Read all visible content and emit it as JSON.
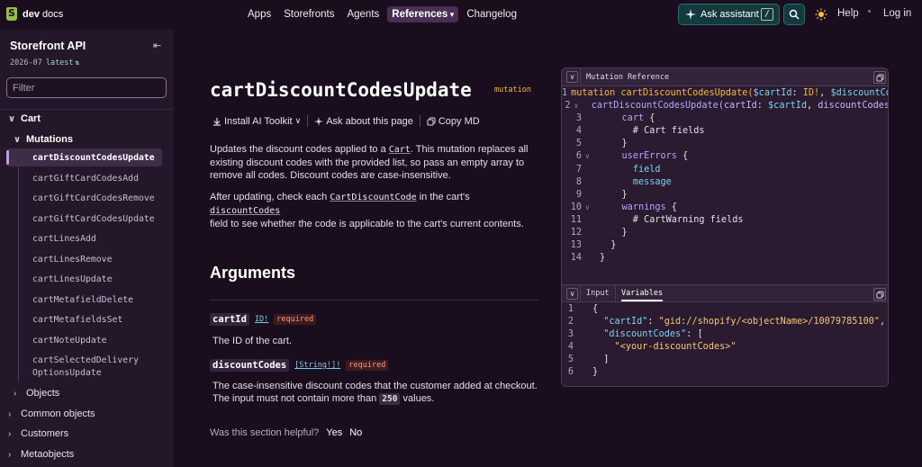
{
  "brand": {
    "name_bold": "dev",
    "name_rest": " docs"
  },
  "nav": {
    "links": [
      "Apps",
      "Storefronts",
      "Agents",
      "References",
      "Changelog"
    ],
    "active": "References",
    "ask_label": "Ask assistant",
    "ask_shortcut": "/",
    "help": "Help",
    "login": "Log in"
  },
  "sidebar": {
    "title": "Storefront API",
    "version": "2026-07",
    "version_tag": "latest",
    "filter_placeholder": "Filter",
    "section": "Cart",
    "subsection": "Mutations",
    "items": [
      "cartDiscountCodesUpdate",
      "cartGiftCardCodesAdd",
      "cartGiftCardCodesRemove",
      "cartGiftCardCodesUpdate",
      "cartLinesAdd",
      "cartLinesRemove",
      "cartLinesUpdate",
      "cartMetafieldDelete",
      "cartMetafieldsSet",
      "cartNoteUpdate",
      "cartSelectedDelivery",
      "OptionsUpdate"
    ],
    "objects": "Objects",
    "groups": [
      "Common objects",
      "Customers",
      "Metaobjects"
    ]
  },
  "main": {
    "title": "cartDiscountCodesUpdate",
    "tag": "mutation",
    "actions": [
      "Install AI Toolkit",
      "Ask about this page",
      "Copy MD"
    ],
    "desc1_a": "Updates the discount codes applied to a ",
    "desc1_link": "Cart",
    "desc1_b": ". This mutation replaces all",
    "desc1_c": "existing discount codes with the provided list, so pass an empty array to",
    "desc1_d": "remove all codes. Discount codes are case-insensitive.",
    "desc2_a": "After updating, check each ",
    "desc2_link1": "CartDiscountCode",
    "desc2_b": " in the cart's ",
    "desc2_link2": "discountCodes",
    "desc2_c": "field to see whether the code is applicable to the cart's current contents.",
    "arguments_heading": "Arguments",
    "args": [
      {
        "name": "cartId",
        "type": "ID!",
        "required": "required",
        "desc": "The ID of the cart."
      },
      {
        "name": "discountCodes",
        "type": "[String!]!",
        "required": "required",
        "desc_a": "The case-insensitive discount codes that the customer added at checkout.",
        "desc_b": "The input must not contain more than ",
        "desc_num": "250",
        "desc_c": " values."
      }
    ],
    "helpful_q": "Was this section helpful?",
    "helpful_yes": "Yes",
    "helpful_no": "No"
  },
  "panel": {
    "header": "Mutation Reference",
    "tabs": [
      "Input",
      "Variables"
    ],
    "active_tab": "Variables"
  },
  "code_lines": [
    [
      [
        "kw",
        "mutation cartDiscountCodesUpdate("
      ],
      [
        "var",
        "$cartId"
      ],
      [
        "ct",
        ": "
      ],
      [
        "kw",
        "ID!"
      ],
      [
        "ct",
        ", "
      ],
      [
        "var",
        "$discountCodes"
      ]
    ],
    [
      [
        "ct",
        "  "
      ],
      [
        "fld",
        "cartDiscountCodesUpdate("
      ],
      [
        "fld2",
        "cartId"
      ],
      [
        "ct",
        ": "
      ],
      [
        "var",
        "$cartId"
      ],
      [
        "ct",
        ", "
      ],
      [
        "fld2",
        "discountCodes"
      ]
    ],
    [
      [
        "ct",
        "    "
      ],
      [
        "fld",
        "cart"
      ],
      [
        "ct",
        " {"
      ]
    ],
    [
      [
        "ct",
        "      # Cart fields"
      ]
    ],
    [
      [
        "ct",
        "    }"
      ]
    ],
    [
      [
        "ct",
        "    "
      ],
      [
        "fld",
        "userErrors"
      ],
      [
        "ct",
        " {"
      ]
    ],
    [
      [
        "ct",
        "      "
      ],
      [
        "var",
        "field"
      ]
    ],
    [
      [
        "ct",
        "      "
      ],
      [
        "var",
        "message"
      ]
    ],
    [
      [
        "ct",
        "    }"
      ]
    ],
    [
      [
        "ct",
        "    "
      ],
      [
        "fld",
        "warnings"
      ],
      [
        "ct",
        " {"
      ]
    ],
    [
      [
        "ct",
        "      # CartWarning fields"
      ]
    ],
    [
      [
        "ct",
        "    }"
      ]
    ],
    [
      [
        "ct",
        "  }"
      ]
    ],
    [
      [
        "ct",
        "}"
      ]
    ]
  ],
  "var_lines": [
    [
      [
        "ct",
        "{"
      ]
    ],
    [
      [
        "ct",
        "  "
      ],
      [
        "key",
        "\"cartId\""
      ],
      [
        "ct",
        ": "
      ],
      [
        "str",
        "\"gid://shopify/<objectName>/10079785100\""
      ],
      [
        "ct",
        ","
      ]
    ],
    [
      [
        "ct",
        "  "
      ],
      [
        "key",
        "\"discountCodes\""
      ],
      [
        "ct",
        ": ["
      ]
    ],
    [
      [
        "ct",
        "    "
      ],
      [
        "str",
        "\"<your-discountCodes>\""
      ]
    ],
    [
      [
        "ct",
        "  ]"
      ]
    ],
    [
      [
        "ct",
        "}"
      ]
    ]
  ]
}
